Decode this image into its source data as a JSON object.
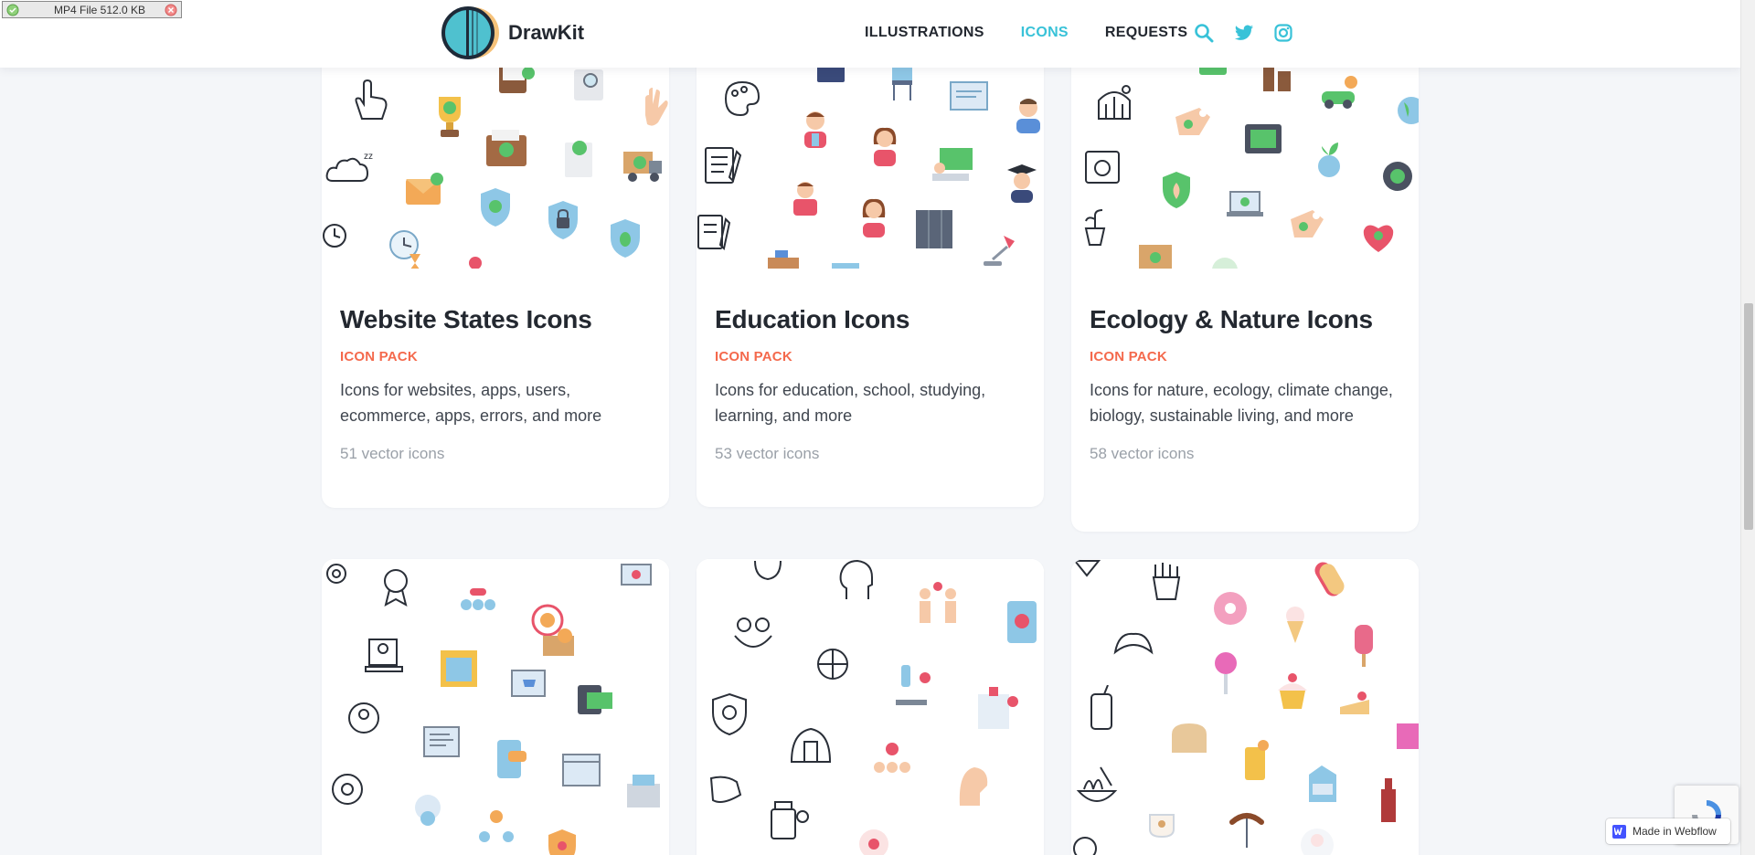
{
  "download_badge": {
    "text": "MP4 File 512.0 KB"
  },
  "nav": {
    "brand": "DrawKit",
    "links": [
      {
        "label": "ILLUSTRATIONS",
        "active": false
      },
      {
        "label": "ICONS",
        "active": true
      },
      {
        "label": "REQUESTS",
        "active": false
      }
    ],
    "icons": [
      "search-icon",
      "twitter-icon",
      "instagram-icon"
    ],
    "accent_color": "#38c2d8"
  },
  "cards": [
    {
      "title": "Website States Icons",
      "kind": "ICON PACK",
      "description": "Icons for websites, apps, users, ecommerce, apps, errors, and more",
      "count": "51 vector icons"
    },
    {
      "title": "Education Icons",
      "kind": "ICON PACK",
      "description": "Icons for education, school, studying, learning, and more",
      "count": "53 vector icons"
    },
    {
      "title": "Ecology & Nature Icons",
      "kind": "ICON PACK",
      "description": "Icons for nature, ecology, climate change, biology, sustainable living, and more",
      "count": "58 vector icons"
    }
  ],
  "colors": {
    "background": "#f4f6f9",
    "kind_label": "#f4694c",
    "muted_text": "#9aa0a8"
  },
  "webflow_badge": {
    "text": "Made in Webflow"
  }
}
